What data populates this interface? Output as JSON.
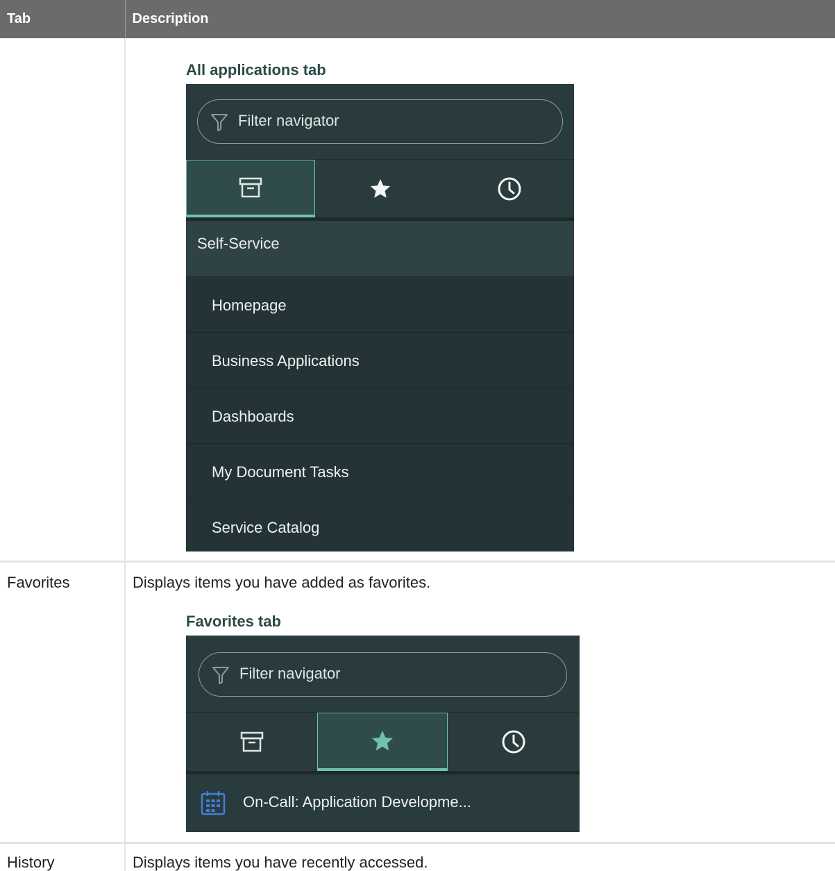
{
  "table": {
    "headers": [
      "Tab",
      "Description"
    ],
    "rows": [
      {
        "tab": "",
        "description": ""
      },
      {
        "tab": "Favorites",
        "description": "Displays items you have added as favorites."
      },
      {
        "tab": "History",
        "description": "Displays items you have recently accessed."
      }
    ]
  },
  "figures": {
    "all_apps": {
      "title": "All applications tab",
      "filter_placeholder": "Filter navigator",
      "active_tab": "all-applications",
      "section": "Self-Service",
      "items": [
        "Homepage",
        "Business Applications",
        "Dashboards",
        "My Document Tasks",
        "Service Catalog"
      ]
    },
    "favorites": {
      "title": "Favorites tab",
      "filter_placeholder": "Filter navigator",
      "active_tab": "favorites",
      "item": "On-Call: Application Developme..."
    }
  },
  "colors": {
    "nav_background": "#2a3b3d",
    "active_tab_accent": "#6fc3ad",
    "header_background": "#6b6b6b",
    "figure_title": "#2b4a46",
    "calendar_icon": "#3f7fd8"
  },
  "icons": [
    "filter-icon",
    "archive-box-icon",
    "star-icon",
    "clock-icon",
    "calendar-icon"
  ]
}
